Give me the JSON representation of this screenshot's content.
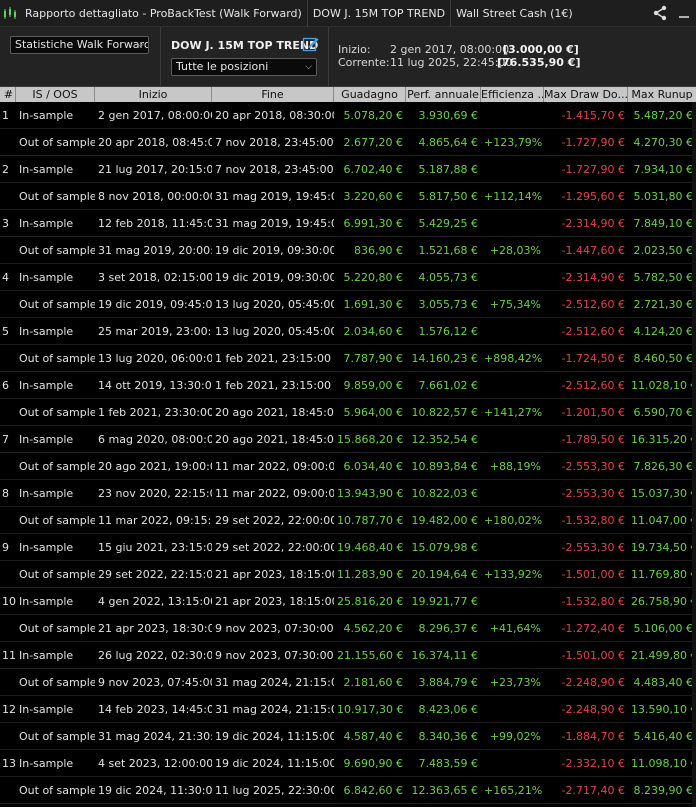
{
  "window": {
    "title": "Rapporto dettagliato - ProBackTest (Walk Forward)",
    "strategy_tab": "DOW J. 15M TOP TREND",
    "instrument_tab": "Wall Street Cash (1€)"
  },
  "toolbar": {
    "view_select": "Statistiche Walk Forward",
    "strategy_name": "DOW J. 15M TOP TREND",
    "positions_select": "Tutte le posizioni",
    "start_label": "Inizio:",
    "start_date": "2 gen 2017, 08:00:00",
    "start_value": "[3.000,00 €]",
    "current_label": "Corrente:",
    "current_date": "11 lug 2025, 22:45:00",
    "current_value": "[76.535,90 €]"
  },
  "colors": {
    "positive": "#6ccf4a",
    "negative": "#e04545",
    "header_bg": "#c7c7c7",
    "background": "#000000"
  },
  "icons": {
    "logo": "chart-candles-icon",
    "share": "share-icon",
    "minimize": "minimize-icon",
    "edit": "edit-icon"
  },
  "columns": [
    "#",
    "IS / OOS",
    "Inizio",
    "Fine",
    "Guadagno",
    "Perf. annuale",
    "Efficienza ...",
    "Max Draw Do...",
    "Max Runup"
  ],
  "rows": [
    {
      "n": "1",
      "type": "In-sample",
      "start": "2 gen 2017, 08:00:00",
      "end": "20 apr 2018, 08:30:00",
      "gain": "5.078,20 €",
      "perf": "3.930,69 €",
      "eff": "",
      "dd": "-1.415,70 €",
      "runup": "5.487,20 €"
    },
    {
      "n": "",
      "type": "Out of sample",
      "start": "20 apr 2018, 08:45:00",
      "end": "7 nov 2018, 23:45:00",
      "gain": "2.677,20 €",
      "perf": "4.865,64 €",
      "eff": "+123,79%",
      "dd": "-1.727,90 €",
      "runup": "4.270,30 €"
    },
    {
      "n": "2",
      "type": "In-sample",
      "start": "21 lug 2017, 20:15:00",
      "end": "7 nov 2018, 23:45:00",
      "gain": "6.702,40 €",
      "perf": "5.187,88 €",
      "eff": "",
      "dd": "-1.727,90 €",
      "runup": "7.934,10 €"
    },
    {
      "n": "",
      "type": "Out of sample",
      "start": "8 nov 2018, 00:00:00",
      "end": "31 mag 2019, 19:45:00",
      "gain": "3.220,60 €",
      "perf": "5.817,50 €",
      "eff": "+112,14%",
      "dd": "-1.295,60 €",
      "runup": "5.031,80 €"
    },
    {
      "n": "3",
      "type": "In-sample",
      "start": "12 feb 2018, 11:45:00",
      "end": "31 mag 2019, 19:45:00",
      "gain": "6.991,30 €",
      "perf": "5.429,25 €",
      "eff": "",
      "dd": "-2.314,90 €",
      "runup": "7.849,10 €"
    },
    {
      "n": "",
      "type": "Out of sample",
      "start": "31 mag 2019, 20:00:00",
      "end": "19 dic 2019, 09:30:00",
      "gain": "836,90 €",
      "perf": "1.521,68 €",
      "eff": "+28,03%",
      "dd": "-1.447,60 €",
      "runup": "2.023,50 €"
    },
    {
      "n": "4",
      "type": "In-sample",
      "start": "3 set 2018, 02:15:00",
      "end": "19 dic 2019, 09:30:00",
      "gain": "5.220,80 €",
      "perf": "4.055,73 €",
      "eff": "",
      "dd": "-2.314,90 €",
      "runup": "5.782,50 €"
    },
    {
      "n": "",
      "type": "Out of sample",
      "start": "19 dic 2019, 09:45:00",
      "end": "13 lug 2020, 05:45:00",
      "gain": "1.691,30 €",
      "perf": "3.055,73 €",
      "eff": "+75,34%",
      "dd": "-2.512,60 €",
      "runup": "2.721,30 €"
    },
    {
      "n": "5",
      "type": "In-sample",
      "start": "25 mar 2019, 23:00:00",
      "end": "13 lug 2020, 05:45:00",
      "gain": "2.034,60 €",
      "perf": "1.576,12 €",
      "eff": "",
      "dd": "-2.512,60 €",
      "runup": "4.124,20 €"
    },
    {
      "n": "",
      "type": "Out of sample",
      "start": "13 lug 2020, 06:00:00",
      "end": "1 feb 2021, 23:15:00",
      "gain": "7.787,90 €",
      "perf": "14.160,23 €",
      "eff": "+898,42%",
      "dd": "-1.724,50 €",
      "runup": "8.460,50 €"
    },
    {
      "n": "6",
      "type": "In-sample",
      "start": "14 ott 2019, 13:30:00",
      "end": "1 feb 2021, 23:15:00",
      "gain": "9.859,00 €",
      "perf": "7.661,02 €",
      "eff": "",
      "dd": "-2.512,60 €",
      "runup": "11.028,10 €"
    },
    {
      "n": "",
      "type": "Out of sample",
      "start": "1 feb 2021, 23:30:00",
      "end": "20 ago 2021, 18:45:00",
      "gain": "5.964,00 €",
      "perf": "10.822,57 €",
      "eff": "+141,27%",
      "dd": "-1.201,50 €",
      "runup": "6.590,70 €"
    },
    {
      "n": "7",
      "type": "In-sample",
      "start": "6 mag 2020, 08:00:00",
      "end": "20 ago 2021, 18:45:00",
      "gain": "15.868,20 €",
      "perf": "12.352,54 €",
      "eff": "",
      "dd": "-1.789,50 €",
      "runup": "16.315,20 €"
    },
    {
      "n": "",
      "type": "Out of sample",
      "start": "20 ago 2021, 19:00:00",
      "end": "11 mar 2022, 09:00:00",
      "gain": "6.034,40 €",
      "perf": "10.893,84 €",
      "eff": "+88,19%",
      "dd": "-2.553,30 €",
      "runup": "7.826,30 €"
    },
    {
      "n": "8",
      "type": "In-sample",
      "start": "23 nov 2020, 22:15:00",
      "end": "11 mar 2022, 09:00:00",
      "gain": "13.943,90 €",
      "perf": "10.822,03 €",
      "eff": "",
      "dd": "-2.553,30 €",
      "runup": "15.037,30 €"
    },
    {
      "n": "",
      "type": "Out of sample",
      "start": "11 mar 2022, 09:15:00",
      "end": "29 set 2022, 22:00:00",
      "gain": "10.787,70 €",
      "perf": "19.482,00 €",
      "eff": "+180,02%",
      "dd": "-1.532,80 €",
      "runup": "11.047,00 €"
    },
    {
      "n": "9",
      "type": "In-sample",
      "start": "15 giu 2021, 23:15:00",
      "end": "29 set 2022, 22:00:00",
      "gain": "19.468,40 €",
      "perf": "15.079,98 €",
      "eff": "",
      "dd": "-2.553,30 €",
      "runup": "19.734,50 €"
    },
    {
      "n": "",
      "type": "Out of sample",
      "start": "29 set 2022, 22:15:00",
      "end": "21 apr 2023, 18:15:00",
      "gain": "11.283,90 €",
      "perf": "20.194,64 €",
      "eff": "+133,92%",
      "dd": "-1.501,00 €",
      "runup": "11.769,80 €"
    },
    {
      "n": "10",
      "type": "In-sample",
      "start": "4 gen 2022, 13:15:00",
      "end": "21 apr 2023, 18:15:00",
      "gain": "25.816,20 €",
      "perf": "19.921,77 €",
      "eff": "",
      "dd": "-1.532,80 €",
      "runup": "26.758,90 €"
    },
    {
      "n": "",
      "type": "Out of sample",
      "start": "21 apr 2023, 18:30:00",
      "end": "9 nov 2023, 07:30:00",
      "gain": "4.562,20 €",
      "perf": "8.296,37 €",
      "eff": "+41,64%",
      "dd": "-1.272,40 €",
      "runup": "5.106,00 €"
    },
    {
      "n": "11",
      "type": "In-sample",
      "start": "26 lug 2022, 02:30:00",
      "end": "9 nov 2023, 07:30:00",
      "gain": "21.155,60 €",
      "perf": "16.374,11 €",
      "eff": "",
      "dd": "-1.501,00 €",
      "runup": "21.499,80 €"
    },
    {
      "n": "",
      "type": "Out of sample",
      "start": "9 nov 2023, 07:45:00",
      "end": "31 mag 2024, 21:15:00",
      "gain": "2.181,60 €",
      "perf": "3.884,79 €",
      "eff": "+23,73%",
      "dd": "-2.248,90 €",
      "runup": "4.483,40 €"
    },
    {
      "n": "12",
      "type": "In-sample",
      "start": "14 feb 2023, 14:45:00",
      "end": "31 mag 2024, 21:15:00",
      "gain": "10.917,30 €",
      "perf": "8.423,06 €",
      "eff": "",
      "dd": "-2.248,90 €",
      "runup": "13.590,10 €"
    },
    {
      "n": "",
      "type": "Out of sample",
      "start": "31 mag 2024, 21:30:00",
      "end": "19 dic 2024, 11:15:00",
      "gain": "4.587,40 €",
      "perf": "8.340,36 €",
      "eff": "+99,02%",
      "dd": "-1.884,70 €",
      "runup": "5.416,40 €"
    },
    {
      "n": "13",
      "type": "In-sample",
      "start": "4 set 2023, 12:00:00",
      "end": "19 dic 2024, 11:15:00",
      "gain": "9.690,90 €",
      "perf": "7.483,59 €",
      "eff": "",
      "dd": "-2.332,10 €",
      "runup": "11.098,10 €"
    },
    {
      "n": "",
      "type": "Out of sample",
      "start": "19 dic 2024, 11:30:00",
      "end": "11 lug 2025, 22:30:00",
      "gain": "6.842,60 €",
      "perf": "12.363,65 €",
      "eff": "+165,21%",
      "dd": "-2.717,40 €",
      "runup": "8.239,90 €"
    }
  ]
}
